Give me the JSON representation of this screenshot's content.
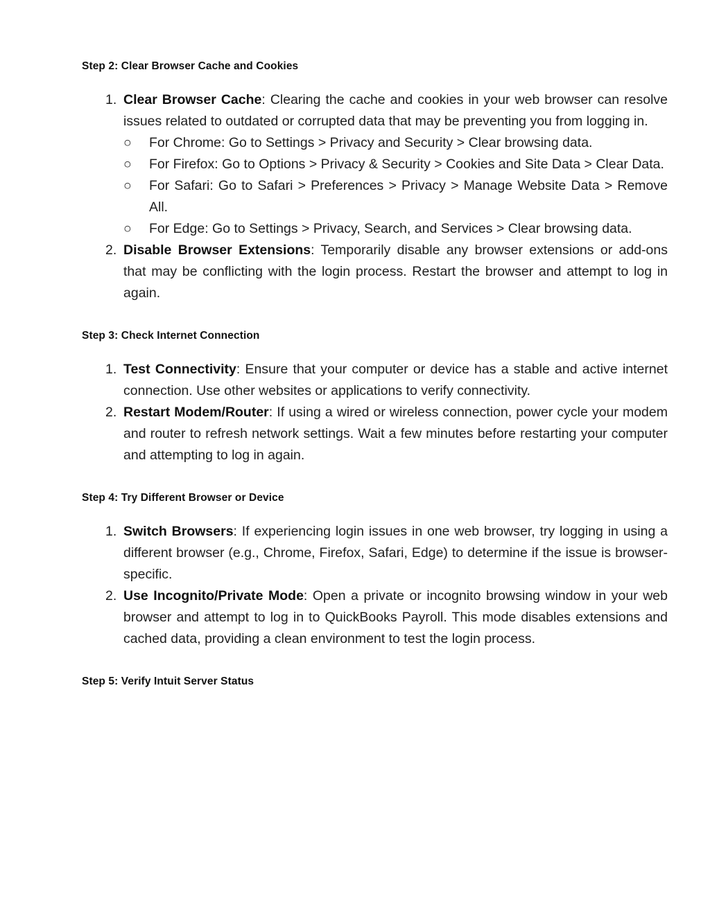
{
  "document": {
    "sections": [
      {
        "heading": "Step 2: Clear Browser Cache and Cookies",
        "items": [
          {
            "marker": "1.",
            "lead": "Clear Browser Cache",
            "text": ": Clearing the cache and cookies in your web browser can resolve issues related to outdated or corrupted data that may be preventing you from logging in.",
            "sublist": [
              {
                "marker": "○",
                "text": "For Chrome: Go to Settings > Privacy and Security > Clear browsing data."
              },
              {
                "marker": "○",
                "text": "For Firefox: Go to Options > Privacy & Security > Cookies and Site Data > Clear Data."
              },
              {
                "marker": "○",
                "text": "For Safari: Go to Safari > Preferences > Privacy > Manage Website Data > Remove All."
              },
              {
                "marker": "○",
                "text": "For Edge: Go to Settings > Privacy, Search, and Services > Clear browsing data."
              }
            ]
          },
          {
            "marker": "2.",
            "lead": "Disable Browser Extensions",
            "text": ": Temporarily disable any browser extensions or add-ons that may be conflicting with the login process. Restart the browser and attempt to log in again.",
            "sublist": []
          }
        ]
      },
      {
        "heading": "Step 3: Check Internet Connection",
        "items": [
          {
            "marker": "1.",
            "lead": "Test Connectivity",
            "text": ": Ensure that your computer or device has a stable and active internet connection. Use other websites or applications to verify connectivity.",
            "sublist": []
          },
          {
            "marker": "2.",
            "lead": "Restart Modem/Router",
            "text": ": If using a wired or wireless connection, power cycle your modem and router to refresh network settings. Wait a few minutes before restarting your computer and attempting to log in again.",
            "sublist": []
          }
        ]
      },
      {
        "heading": "Step 4: Try Different Browser or Device",
        "items": [
          {
            "marker": "1.",
            "lead": "Switch Browsers",
            "text": ": If experiencing login issues in one web browser, try logging in using a different browser (e.g., Chrome, Firefox, Safari, Edge) to determine if the issue is browser-specific.",
            "sublist": []
          },
          {
            "marker": "2.",
            "lead": "Use Incognito/Private Mode",
            "text": ": Open a private or incognito browsing window in your web browser and attempt to log in to QuickBooks Payroll. This mode disables extensions and cached data, providing a clean environment to test the login process.",
            "sublist": []
          }
        ]
      },
      {
        "heading": "Step 5: Verify Intuit Server Status",
        "items": []
      }
    ]
  }
}
